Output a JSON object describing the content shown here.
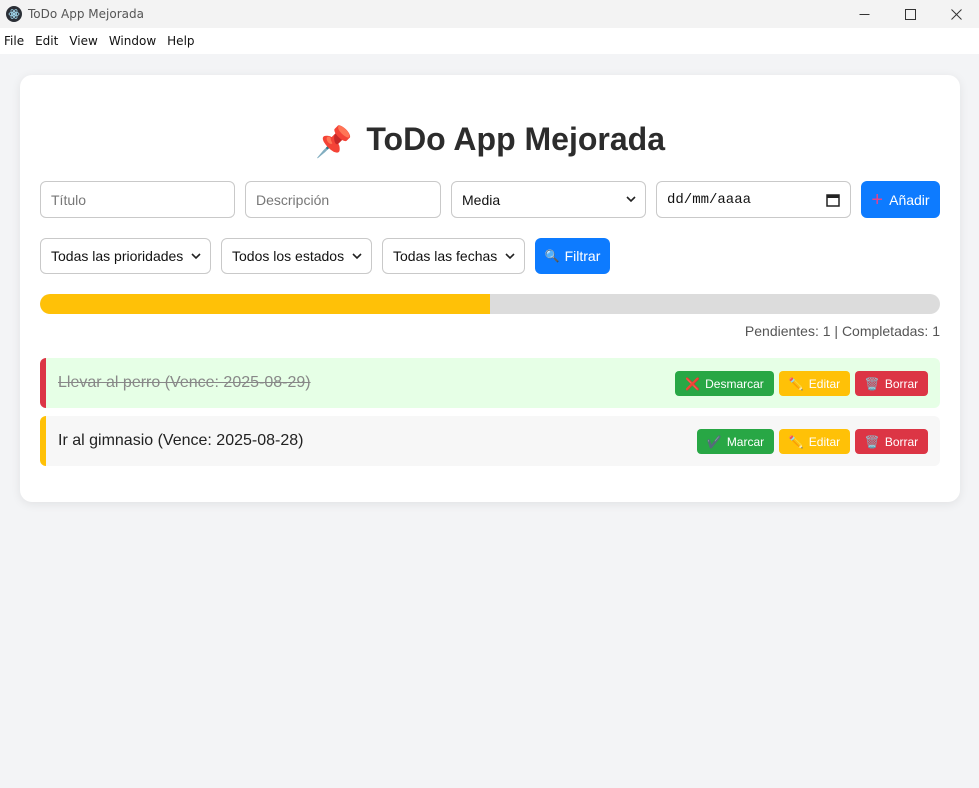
{
  "window": {
    "title": "ToDo App Mejorada"
  },
  "menu": [
    "File",
    "Edit",
    "View",
    "Window",
    "Help"
  ],
  "header": {
    "icon": "pushpin-icon",
    "emoji": "📌",
    "title": "ToDo App Mejorada"
  },
  "form": {
    "title_placeholder": "Título",
    "description_placeholder": "Descripción",
    "priority_value": "Media",
    "date_placeholder": "dd/mm/aaaa",
    "add_label": "Añadir",
    "add_icon": "+"
  },
  "filters": {
    "priority": "Todas las prioridades",
    "status": "Todos los estados",
    "date": "Todas las fechas",
    "filter_label": "Filtrar",
    "filter_icon": "🔍"
  },
  "progress": {
    "fraction": 0.5,
    "counts_text": "Pendientes: 1 | Completadas: 1"
  },
  "tasks": [
    {
      "text": "Llevar al perro (Vence: 2025-08-29)",
      "completed": true,
      "toggle_icon": "❌",
      "toggle_label": "Desmarcar",
      "edit_icon": "✏️",
      "edit_label": "Editar",
      "delete_icon": "🗑️",
      "delete_label": "Borrar"
    },
    {
      "text": "Ir al gimnasio (Vence: 2025-08-28)",
      "completed": false,
      "toggle_icon": "✔️",
      "toggle_label": "Marcar",
      "edit_icon": "✏️",
      "edit_label": "Editar",
      "delete_icon": "🗑️",
      "delete_label": "Borrar"
    }
  ],
  "colors": {
    "accent_blue": "#0d7bff",
    "progress_fill": "#ffc107",
    "completed_bg": "#e6ffe6",
    "danger": "#dc3545",
    "success": "#28a745",
    "warning": "#ffc107"
  }
}
